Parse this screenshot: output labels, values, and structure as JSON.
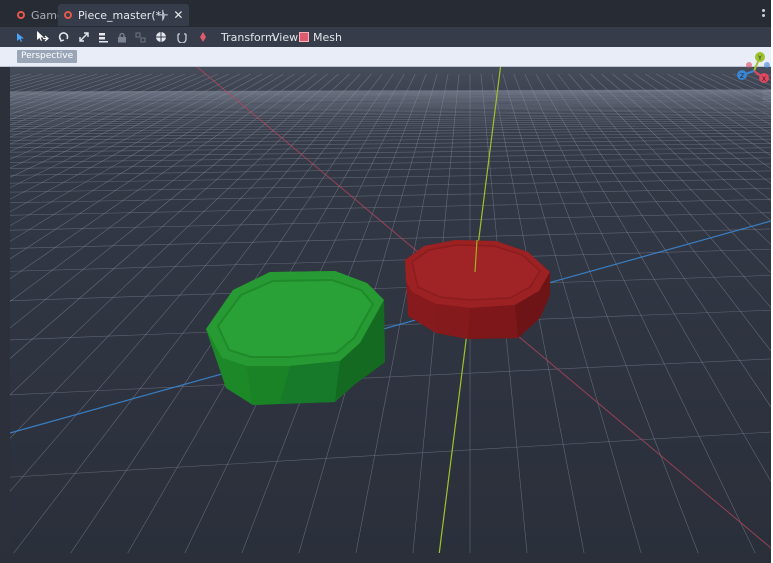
{
  "tabs": [
    {
      "label": "Game",
      "active": false
    },
    {
      "label": "Piece_master(*)",
      "active": true
    }
  ],
  "toolbar": {
    "transform_label": "Transform",
    "view_label": "View",
    "mesh_label": "Mesh",
    "tool_icons": [
      "select-icon",
      "move-icon",
      "rotate-icon",
      "scale-icon",
      "list-select-icon",
      "lock-icon",
      "group-icon",
      "local-space-icon",
      "snap-icon",
      "light-icon"
    ]
  },
  "viewport": {
    "mode_label": "Perspective",
    "objects": [
      {
        "name": "green-octagon-piece",
        "color": "#1f8a2e"
      },
      {
        "name": "red-octagon-piece",
        "color": "#8c1f22"
      }
    ],
    "axes_colors": {
      "x": "#d14a5c",
      "y": "#9ec22d",
      "z": "#3a86d1"
    }
  },
  "gizmo": {
    "labels": [
      "Y",
      "X",
      "Z"
    ]
  }
}
